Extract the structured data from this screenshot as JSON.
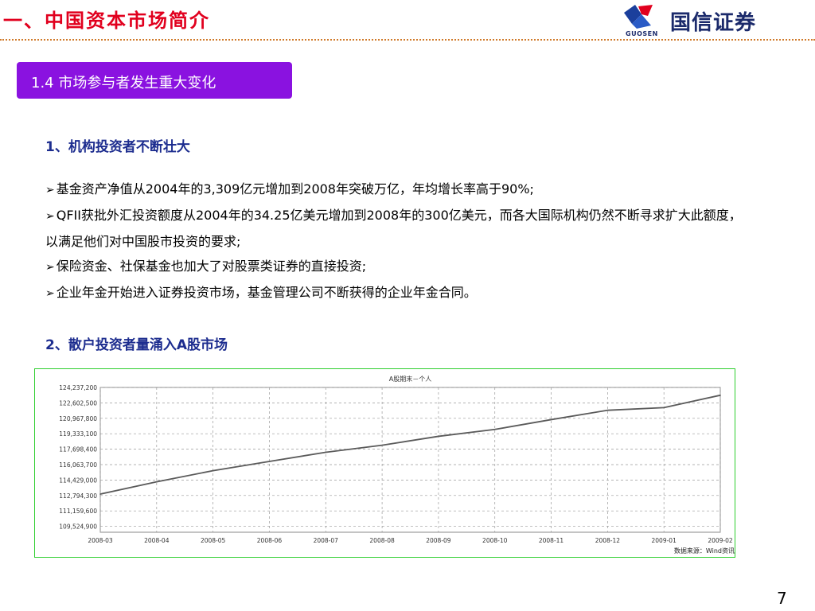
{
  "header": {
    "title": "一、中国资本市场简介",
    "logo_brand": "国信证券",
    "logo_sub": "GUOSEN"
  },
  "section": {
    "label": "1.4 市场参与者发生重大变化"
  },
  "points": {
    "h1": "1、机构投资者不断壮大",
    "b1": "基金资产净值从2004年的3,309亿元增加到2008年突破万亿，年均增长率高于90%;",
    "b2": "QFII获批外汇投资额度从2004年的34.25亿美元增加到2008年的300亿美元，而各大国际机构仍然不断寻求扩大此额度，以满足他们对中国股市投资的要求;",
    "b3": "保险资金、社保基金也加大了对股票类证券的直接投资;",
    "b4": "企业年金开始进入证券投资市场，基金管理公司不断获得的企业年金合同。",
    "h2": "2、散户投资者量涌入A股市场"
  },
  "chart_data": {
    "type": "line",
    "title": "A股期末－个人",
    "source": "数据来源：Wind资讯",
    "x": [
      "2008-03",
      "2008-04",
      "2008-05",
      "2008-06",
      "2008-07",
      "2008-08",
      "2008-09",
      "2008-10",
      "2008-11",
      "2008-12",
      "2009-01",
      "2009-02"
    ],
    "series": [
      {
        "values": [
          112940,
          114240,
          115420,
          116400,
          117370,
          118120,
          119060,
          119790,
          120830,
          121820,
          122100,
          123410
        ]
      }
    ],
    "yticks": [
      "124,237,200",
      "122,602,500",
      "120,967,800",
      "119,333,100",
      "117,698,400",
      "116,063,700",
      "114,429,000",
      "112,794,300",
      "111,159,600",
      "109,524,900"
    ],
    "ylim": [
      108900,
      124237.2
    ],
    "grid": true,
    "legend": "none",
    "line_color": "#5a5a5a"
  },
  "page_number": "7"
}
